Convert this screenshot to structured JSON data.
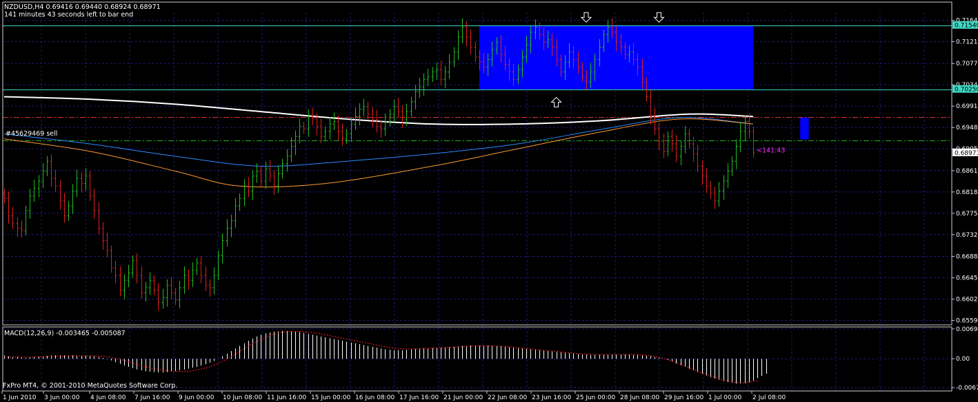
{
  "header": {
    "symbol_line": "NZDUSD,H4  0.69416 0.69440 0.68924 0.68971",
    "timer_text": "141 minutes 43 seconds left to bar end"
  },
  "order_label": "#45629469 sell",
  "copyright": "FxPro MT4, © 2001-2010 MetaQuotes Software Corp.",
  "macd_header": "MACD(12,26,9) -0.003465 -0.005087",
  "colors": {
    "background": "#000000",
    "grid": "#1c1c78",
    "border": "#cfcfcf",
    "bull": "#1fbf1f",
    "bear": "#e01f1f",
    "rect": "#0000ff",
    "ma_white": "#ffffff",
    "ma_blue": "#2a8cff",
    "ma_orange": "#ff9a2e",
    "resistance_line": "#40d8c8",
    "order_line": "#e03030",
    "sl_line": "#20b020",
    "timer_label": "#ff30ff",
    "price_tag": "#40d8c8"
  },
  "chart_data": [
    {
      "type": "candlestick",
      "symbol": "NZDUSD",
      "timeframe": "H4",
      "ylim": [
        0.655,
        0.718
      ],
      "y_ticks": [
        "0.71640",
        "0.71210",
        "0.70770",
        "0.70340",
        "0.69910",
        "0.69480",
        "0.69050",
        "0.68610",
        "0.68180",
        "0.67750",
        "0.67320",
        "0.66880",
        "0.66450",
        "0.66020",
        "0.65590"
      ],
      "x_ticks": [
        "1 Jun 2010",
        "3 Jun 00:00",
        "4 Jun 08:00",
        "7 Jun 16:00",
        "9 Jun 00:00",
        "10 Jun 08:00",
        "11 Jun 16:00",
        "15 Jun 00:00",
        "16 Jun 08:00",
        "17 Jun 16:00",
        "21 Jun 00:00",
        "22 Jun 08:00",
        "23 Jun 16:00",
        "25 Jun 00:00",
        "28 Jun 08:00",
        "29 Jun 16:00",
        "1 Jul 00:00",
        "2 Jul 08:00"
      ],
      "price_tags": [
        {
          "value": 0.7154,
          "label": "0.71540"
        },
        {
          "value": 0.7025,
          "label": "0.70250"
        },
        {
          "value": 0.68971,
          "label": "0.68971"
        }
      ],
      "closes": [
        0.6805,
        0.677,
        0.6755,
        0.6745,
        0.674,
        0.678,
        0.681,
        0.6825,
        0.684,
        0.686,
        0.688,
        0.6845,
        0.683,
        0.68,
        0.677,
        0.679,
        0.682,
        0.6845,
        0.6835,
        0.685,
        0.681,
        0.678,
        0.6745,
        0.672,
        0.67,
        0.6665,
        0.665,
        0.662,
        0.664,
        0.6655,
        0.668,
        0.665,
        0.6615,
        0.6625,
        0.664,
        0.662,
        0.6595,
        0.6605,
        0.663,
        0.6615,
        0.66,
        0.6625,
        0.665,
        0.664,
        0.666,
        0.6675,
        0.665,
        0.663,
        0.6625,
        0.665,
        0.669,
        0.672,
        0.6745,
        0.676,
        0.679,
        0.6805,
        0.683,
        0.682,
        0.685,
        0.686,
        0.684,
        0.6865,
        0.685,
        0.683,
        0.6855,
        0.6875,
        0.689,
        0.691,
        0.693,
        0.695,
        0.6945,
        0.697,
        0.6965,
        0.695,
        0.693,
        0.694,
        0.6955,
        0.696,
        0.694,
        0.6925,
        0.6935,
        0.6955,
        0.697,
        0.6985,
        0.699,
        0.6975,
        0.6965,
        0.695,
        0.6945,
        0.696,
        0.6975,
        0.699,
        0.698,
        0.6965,
        0.698,
        0.7,
        0.702,
        0.703,
        0.7045,
        0.705,
        0.706,
        0.7065,
        0.7045,
        0.706,
        0.708,
        0.71,
        0.713,
        0.715,
        0.713,
        0.711,
        0.709,
        0.708,
        0.707,
        0.7085,
        0.7105,
        0.712,
        0.7095,
        0.7075,
        0.706,
        0.7045,
        0.7065,
        0.709,
        0.7115,
        0.714,
        0.715,
        0.7135,
        0.712,
        0.7125,
        0.711,
        0.7085,
        0.706,
        0.708,
        0.71,
        0.7085,
        0.707,
        0.705,
        0.704,
        0.706,
        0.7085,
        0.711,
        0.7135,
        0.715,
        0.714,
        0.712,
        0.711,
        0.7095,
        0.71,
        0.7085,
        0.707,
        0.704,
        0.701,
        0.697,
        0.6945,
        0.692,
        0.69,
        0.693,
        0.6915,
        0.689,
        0.691,
        0.6935,
        0.6915,
        0.6895,
        0.687,
        0.685,
        0.683,
        0.6815,
        0.68,
        0.682,
        0.684,
        0.686,
        0.688,
        0.691,
        0.694,
        0.696,
        0.694,
        0.6897
      ],
      "moving_averages": [
        {
          "color": "#ffffff",
          "points": [
            [
              0,
              0.701
            ],
            [
              20,
              0.7005
            ],
            [
              40,
              0.6995
            ],
            [
              60,
              0.698
            ],
            [
              80,
              0.6965
            ],
            [
              100,
              0.6955
            ],
            [
              120,
              0.6955
            ],
            [
              140,
              0.6962
            ],
            [
              160,
              0.6975
            ],
            [
              175,
              0.697
            ]
          ]
        },
        {
          "color": "#2a8cff",
          "points": [
            [
              0,
              0.6935
            ],
            [
              20,
              0.6915
            ],
            [
              40,
              0.689
            ],
            [
              60,
              0.687
            ],
            [
              80,
              0.688
            ],
            [
              100,
              0.6895
            ],
            [
              120,
              0.6915
            ],
            [
              140,
              0.6945
            ],
            [
              158,
              0.6968
            ],
            [
              175,
              0.6955
            ]
          ]
        },
        {
          "color": "#ff9a2e",
          "points": [
            [
              0,
              0.6925
            ],
            [
              20,
              0.69
            ],
            [
              40,
              0.686
            ],
            [
              55,
              0.683
            ],
            [
              75,
              0.6835
            ],
            [
              100,
              0.687
            ],
            [
              120,
              0.6905
            ],
            [
              140,
              0.694
            ],
            [
              158,
              0.6965
            ],
            [
              175,
              0.6955
            ]
          ]
        }
      ],
      "horizontal_lines": [
        {
          "value": 0.7154,
          "color": "#40d8c8",
          "style": "solid"
        },
        {
          "value": 0.7025,
          "color": "#40d8c8",
          "style": "solid"
        },
        {
          "value": 0.6969,
          "color": "#e03030",
          "style": "dashdot"
        },
        {
          "value": 0.6922,
          "color": "#20b020",
          "style": "dashdot"
        }
      ],
      "rectangles": [
        {
          "x0": 111,
          "x1": 175,
          "y0": 0.7025,
          "y1": 0.7154,
          "color": "#0000ff"
        },
        {
          "x0": 186,
          "x1": 188,
          "y0": 0.6924,
          "y1": 0.6968,
          "color": "#0000ff"
        }
      ],
      "arrows": [
        {
          "bar": 136,
          "value": 0.717,
          "dir": "down"
        },
        {
          "bar": 153,
          "value": 0.717,
          "dir": "down"
        },
        {
          "bar": 129,
          "value": 0.6999,
          "dir": "up"
        }
      ],
      "timer_label": {
        "text": "<141:43",
        "value": 0.6902
      }
    },
    {
      "type": "histogram",
      "name": "MACD(12,26,9)",
      "ylim": [
        -0.0075,
        0.0074
      ],
      "y_ticks": [
        "0.00695",
        "0.00",
        "-0.00672"
      ],
      "main": [
        0.0008,
        0.0006,
        0.0005,
        0.0004,
        0.0003,
        0.0002,
        0.0003,
        0.0004,
        0.0005,
        0.0006,
        0.0007,
        0.0008,
        0.0008,
        0.0008,
        0.0008,
        0.0008,
        0.0008,
        0.0007,
        0.0007,
        0.0007,
        0.0007,
        0.0006,
        0.0004,
        0.0002,
        -0.0001,
        -0.0004,
        -0.0008,
        -0.0012,
        -0.0016,
        -0.0019,
        -0.0022,
        -0.0025,
        -0.0027,
        -0.0029,
        -0.003,
        -0.0031,
        -0.0032,
        -0.0032,
        -0.0031,
        -0.003,
        -0.0029,
        -0.0027,
        -0.0025,
        -0.0023,
        -0.0021,
        -0.0019,
        -0.0016,
        -0.0013,
        -0.0009,
        -0.0005,
        0.0,
        0.0006,
        0.0012,
        0.0018,
        0.0024,
        0.003,
        0.0036,
        0.0042,
        0.0047,
        0.0052,
        0.0056,
        0.0059,
        0.0061,
        0.0063,
        0.0064,
        0.0065,
        0.0065,
        0.0064,
        0.0063,
        0.0062,
        0.006,
        0.0058,
        0.0056,
        0.0054,
        0.0052,
        0.005,
        0.0048,
        0.0046,
        0.0044,
        0.0042,
        0.004,
        0.0038,
        0.0036,
        0.0034,
        0.0032,
        0.003,
        0.0028,
        0.0026,
        0.0024,
        0.0022,
        0.0021,
        0.002,
        0.002,
        0.002,
        0.0021,
        0.0022,
        0.0023,
        0.0024,
        0.0024,
        0.0025,
        0.0025,
        0.0026,
        0.0026,
        0.0027,
        0.0027,
        0.0028,
        0.0029,
        0.003,
        0.003,
        0.0031,
        0.0031,
        0.0031,
        0.0031,
        0.0031,
        0.003,
        0.003,
        0.0029,
        0.0028,
        0.0027,
        0.0026,
        0.0025,
        0.0024,
        0.0023,
        0.0022,
        0.0021,
        0.002,
        0.0019,
        0.0018,
        0.0017,
        0.0016,
        0.0015,
        0.0014,
        0.0013,
        0.0012,
        0.0011,
        0.001,
        0.001,
        0.0009,
        0.0009,
        0.0009,
        0.0009,
        0.0009,
        0.0009,
        0.001,
        0.001,
        0.001,
        0.001,
        0.0009,
        0.0009,
        0.0008,
        0.0007,
        0.0006,
        0.0004,
        0.0002,
        0.0,
        -0.0003,
        -0.0007,
        -0.0011,
        -0.0015,
        -0.0019,
        -0.0023,
        -0.0027,
        -0.0031,
        -0.0035,
        -0.0039,
        -0.0043,
        -0.0046,
        -0.0049,
        -0.0052,
        -0.0054,
        -0.0056,
        -0.0058,
        -0.0058,
        -0.0057,
        -0.0055,
        -0.0051,
        -0.0045,
        -0.004,
        -0.0035
      ],
      "signal": [
        0.0004,
        0.0004,
        0.0004,
        0.0004,
        0.0004,
        0.0004,
        0.0004,
        0.0004,
        0.0004,
        0.0005,
        0.0005,
        0.0005,
        0.0006,
        0.0006,
        0.0006,
        0.0006,
        0.0007,
        0.0007,
        0.0007,
        0.0007,
        0.0007,
        0.0007,
        0.0006,
        0.0006,
        0.0005,
        0.0003,
        0.0001,
        -0.0001,
        -0.0004,
        -0.0007,
        -0.001,
        -0.0013,
        -0.0016,
        -0.0019,
        -0.0021,
        -0.0023,
        -0.0025,
        -0.0027,
        -0.0028,
        -0.0029,
        -0.003,
        -0.003,
        -0.0029,
        -0.0029,
        -0.0028,
        -0.0026,
        -0.0024,
        -0.0022,
        -0.0019,
        -0.0015,
        -0.0011,
        -0.0006,
        -0.0001,
        0.0005,
        0.0011,
        0.0017,
        0.0023,
        0.0029,
        0.0035,
        0.004,
        0.0045,
        0.005,
        0.0054,
        0.0057,
        0.006,
        0.0062,
        0.0063,
        0.0064,
        0.0064,
        0.0064,
        0.0063,
        0.0062,
        0.0061,
        0.006,
        0.0058,
        0.0056,
        0.0054,
        0.0052,
        0.005,
        0.0048,
        0.0046,
        0.0044,
        0.0042,
        0.004,
        0.0038,
        0.0036,
        0.0034,
        0.0032,
        0.003,
        0.0028,
        0.0026,
        0.0025,
        0.0024,
        0.0023,
        0.0023,
        0.0023,
        0.0023,
        0.0023,
        0.0024,
        0.0024,
        0.0025,
        0.0025,
        0.0026,
        0.0026,
        0.0027,
        0.0027,
        0.0028,
        0.0028,
        0.0029,
        0.0029,
        0.003,
        0.003,
        0.003,
        0.003,
        0.003,
        0.003,
        0.0029,
        0.0029,
        0.0028,
        0.0027,
        0.0026,
        0.0025,
        0.0024,
        0.0023,
        0.0022,
        0.0021,
        0.002,
        0.0019,
        0.0018,
        0.0017,
        0.0016,
        0.0015,
        0.0014,
        0.0013,
        0.0012,
        0.0012,
        0.0011,
        0.0011,
        0.001,
        0.001,
        0.001,
        0.001,
        0.001,
        0.001,
        0.001,
        0.001,
        0.001,
        0.001,
        0.001,
        0.0009,
        0.0008,
        0.0007,
        0.0005,
        0.0003,
        0.0001,
        -0.0002,
        -0.0005,
        -0.0009,
        -0.0013,
        -0.0017,
        -0.0021,
        -0.0025,
        -0.0029,
        -0.0033,
        -0.0036,
        -0.004,
        -0.0043,
        -0.0046,
        -0.0049,
        -0.0051,
        -0.0053,
        -0.0055,
        -0.0056,
        -0.0056,
        -0.0055,
        -0.0053,
        -0.0051
      ]
    }
  ]
}
